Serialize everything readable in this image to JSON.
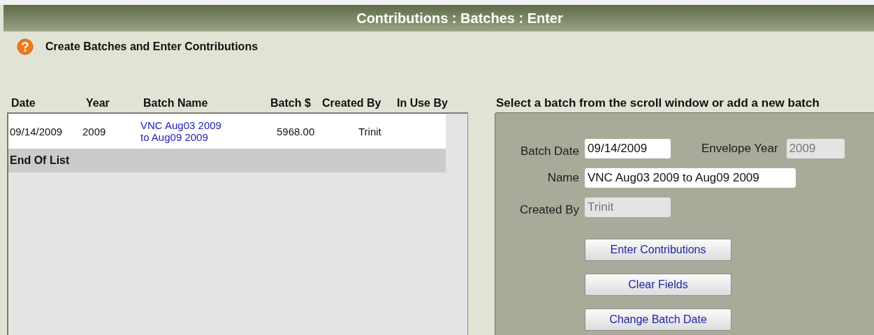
{
  "window": {
    "title": "Contributions : Batches : Enter"
  },
  "header": {
    "heading": "Create Batches and Enter Contributions"
  },
  "batch_list": {
    "columns": [
      "Date",
      "Year",
      "Batch Name",
      "Batch $",
      "Created By",
      "In Use By"
    ],
    "rows": [
      {
        "date": "09/14/2009",
        "year": "2009",
        "batch_name": "VNC Aug03 2009 to Aug09 2009",
        "amount": "5968.00",
        "created_by": "Trinit",
        "selected": false
      }
    ],
    "footer": "End Of List"
  },
  "form": {
    "instruction": "Select a batch from the scroll window or add a new batch",
    "fields": [
      {
        "label": "Batch Date",
        "value": "09/14/2009",
        "disabled": false
      },
      {
        "label": "Envelope Year",
        "value": "2009",
        "disabled": true
      },
      {
        "label": "Name",
        "value": "VNC Aug03 2009 to Aug09 2009",
        "disabled": false
      },
      {
        "label": "Created By",
        "value": "Trinit",
        "disabled": true
      }
    ],
    "buttons": [
      "Enter Contributions",
      "Clear Fields",
      "Change Batch Date"
    ]
  }
}
